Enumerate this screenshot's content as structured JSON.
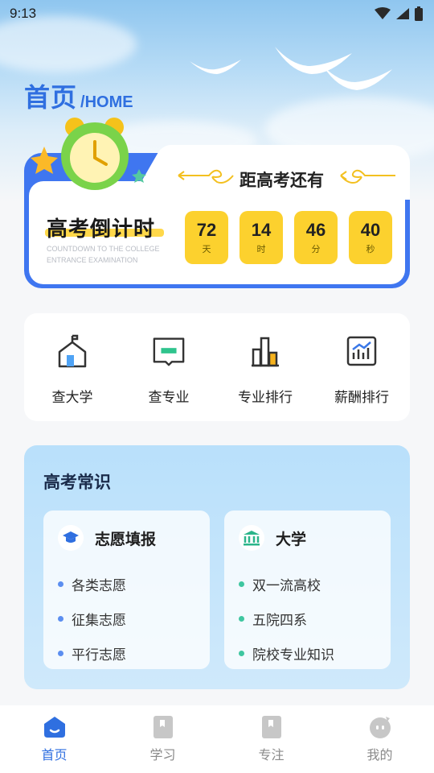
{
  "status_bar": {
    "time": "9:13"
  },
  "header": {
    "title_cn": "首页",
    "title_en": "/HOME"
  },
  "countdown": {
    "heading": "距高考还有",
    "title": "高考倒计时",
    "subtitle": "COUNTDOWN TO THE COLLEGE ENTRANCE EXAMINATION",
    "units": [
      {
        "value": "72",
        "unit": "天"
      },
      {
        "value": "14",
        "unit": "时"
      },
      {
        "value": "46",
        "unit": "分"
      },
      {
        "value": "40",
        "unit": "秒"
      }
    ]
  },
  "menu": {
    "items": [
      {
        "label": "查大学",
        "icon": "school-building-icon"
      },
      {
        "label": "查专业",
        "icon": "open-book-icon"
      },
      {
        "label": "专业排行",
        "icon": "bar-chart-icon"
      },
      {
        "label": "薪酬排行",
        "icon": "trend-chart-icon"
      }
    ]
  },
  "knowledge": {
    "title": "高考常识",
    "cards": [
      {
        "title": "志愿填报",
        "icon": "graduation-cap-icon",
        "dot_color": "#5b8ef0",
        "items": [
          "各类志愿",
          "征集志愿",
          "平行志愿"
        ]
      },
      {
        "title": "大学",
        "icon": "university-icon",
        "dot_color": "#3fc6a0",
        "items": [
          "双一流高校",
          "五院四系",
          "院校专业知识"
        ]
      }
    ]
  },
  "tabbar": {
    "items": [
      {
        "label": "首页",
        "icon": "home-icon",
        "active": true
      },
      {
        "label": "学习",
        "icon": "book-icon",
        "active": false
      },
      {
        "label": "专注",
        "icon": "bookmark-book-icon",
        "active": false
      },
      {
        "label": "我的",
        "icon": "profile-icon",
        "active": false
      }
    ]
  },
  "colors": {
    "accent": "#2f6fe0",
    "countdown_box": "#fcd12e",
    "inactive": "#c7c7c7"
  }
}
